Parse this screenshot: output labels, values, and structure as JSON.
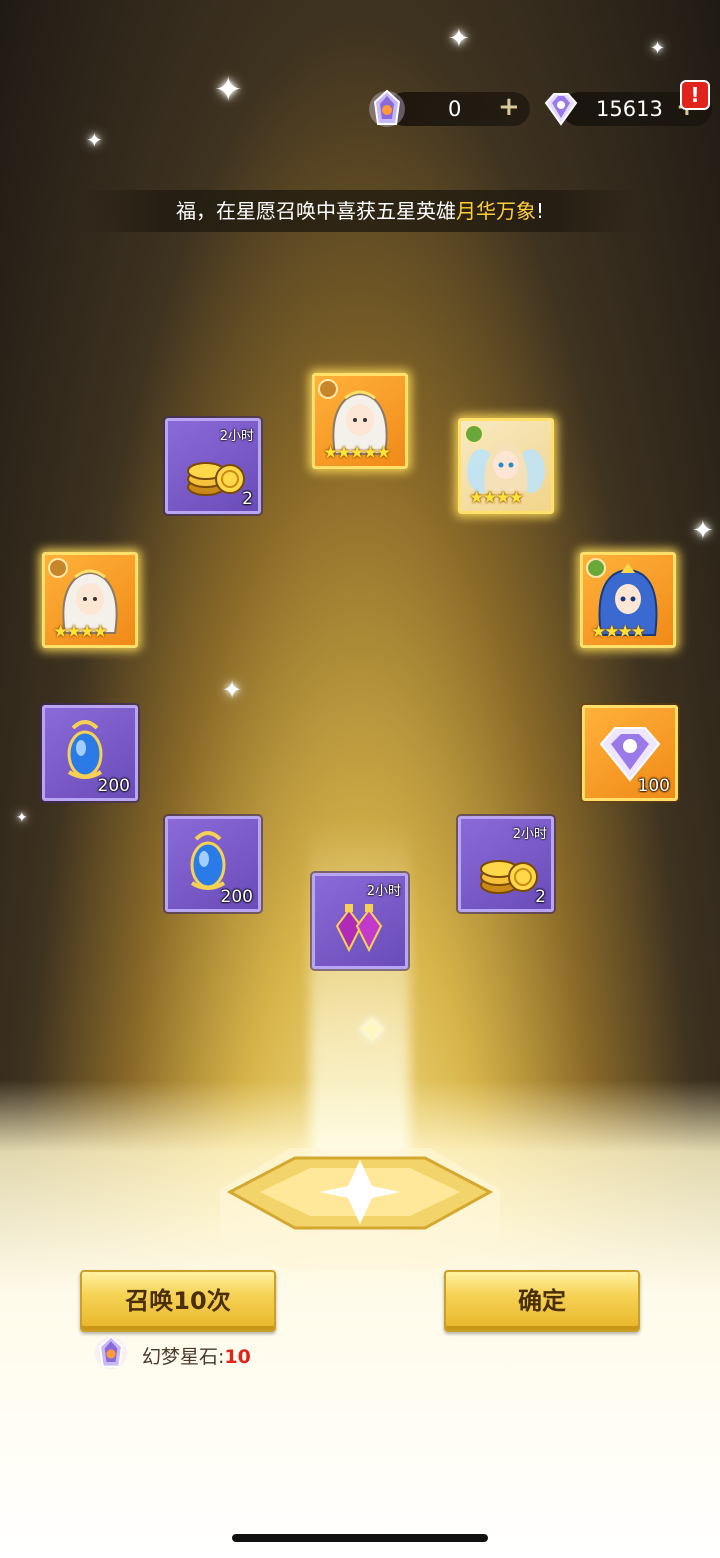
{
  "currencies": {
    "stone_amount": "0",
    "diamond_amount": "15613",
    "alert": "!"
  },
  "marquee": {
    "prefix": "福，在星愿召唤中喜获五星英雄",
    "hero_name": "月华万象",
    "suffix": "!"
  },
  "rewards": [
    {
      "id": "r1",
      "type": "gold-coins",
      "tag": "2小时",
      "qty": "2",
      "frame": "purple"
    },
    {
      "id": "r2",
      "type": "hero",
      "element": "gold",
      "stars": "★★★★★",
      "frame": "gold"
    },
    {
      "id": "r3",
      "type": "hero",
      "element": "green",
      "stars": "★★★★",
      "frame": "gold"
    },
    {
      "id": "r4",
      "type": "hero",
      "element": "gold",
      "stars": "★★★★",
      "frame": "gold"
    },
    {
      "id": "r5",
      "type": "hero",
      "element": "green",
      "stars": "★★★★",
      "frame": "gold"
    },
    {
      "id": "r6",
      "type": "blue-crystal",
      "qty": "200",
      "frame": "purple"
    },
    {
      "id": "r7",
      "type": "diamond",
      "qty": "100",
      "frame": "gold"
    },
    {
      "id": "r8",
      "type": "blue-crystal",
      "qty": "200",
      "frame": "purple"
    },
    {
      "id": "r9",
      "type": "gold-coins",
      "tag": "2小时",
      "qty": "2",
      "frame": "purple"
    },
    {
      "id": "r10",
      "type": "exp-potion",
      "tag": "2小时",
      "frame": "purple"
    }
  ],
  "buttons": {
    "summon_label": "召唤10次",
    "confirm_label": "确定"
  },
  "cost": {
    "label": "幻梦星石:",
    "amount": "10"
  },
  "colors": {
    "highlight": "#ffcf3a",
    "cost_red": "#e0241c",
    "button_gold": "#f6d254",
    "card_purple": "#7a5cc8",
    "card_orange": "#f59a22"
  }
}
